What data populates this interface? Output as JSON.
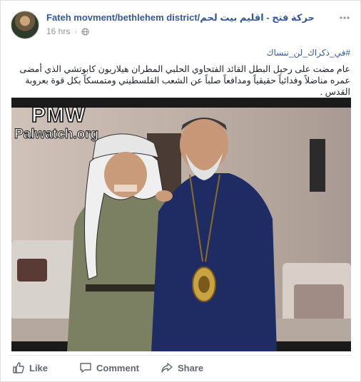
{
  "post": {
    "page_name": "Fateh movment/bethlehem district/حركة فتح - اقليم بيت لحم",
    "time": "16 hrs",
    "privacy_icon": "globe-icon",
    "hashtag": "#في_ذكراك_لن_ننساك",
    "text": "عام مضت على رحيل البطل القائد الفتحاوي الحلبي المطران هيلاريون كابوتشي الذي أمضى عمره مناضلاً وفدائياً حقيقياً ومدافعاً صلباً عن الشعب الفلسطيني ومتمسكاً بكل قوة بعروبة القدس ."
  },
  "photo": {
    "watermark_top": "PMW",
    "watermark_bottom": "Palwatch.org"
  },
  "actions": {
    "like": "Like",
    "comment": "Comment",
    "share": "Share"
  },
  "colors": {
    "link": "#365899",
    "muted": "#90949c",
    "action_text": "#606770"
  }
}
